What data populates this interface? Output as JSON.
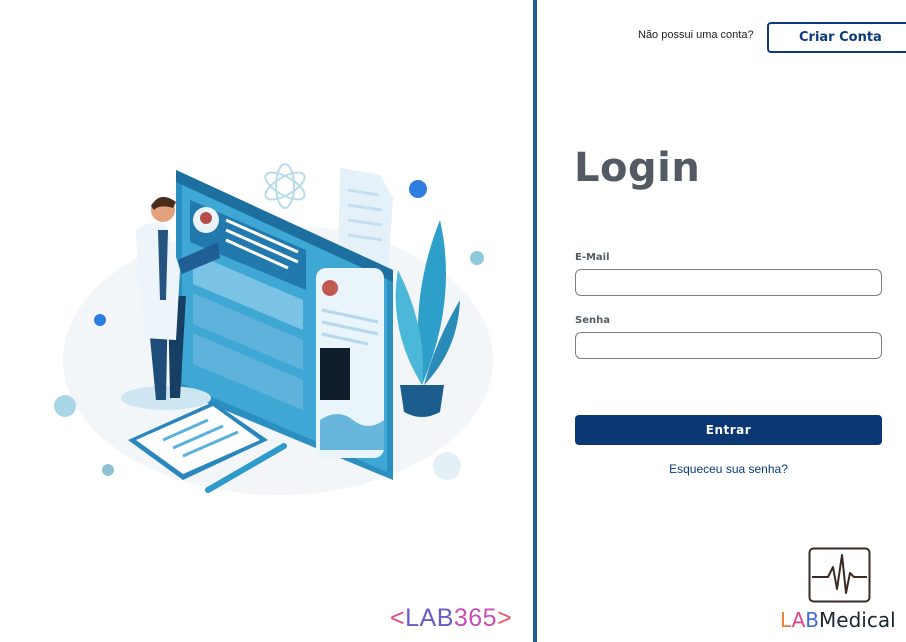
{
  "header": {
    "no_account_text": "Não possui uma conta?",
    "create_account_label": "Criar Conta"
  },
  "login": {
    "title": "Login",
    "email_label": "E-Mail",
    "email_value": "",
    "password_label": "Senha",
    "password_value": "",
    "submit_label": "Entrar",
    "forgot_label": "Esqueceu sua senha?"
  },
  "branding": {
    "left_logo": {
      "open": "<",
      "lab": "LAB",
      "num": "365",
      "close": ">"
    },
    "right_logo": {
      "l": "L",
      "a": "A",
      "b": "B",
      "rest": "Medical"
    }
  },
  "colors": {
    "divider": "#1f5f95",
    "primary": "#0b3775",
    "title": "#545a63"
  },
  "icons": [
    "doctor-dashboard-illustration",
    "heartbeat-monitor-icon"
  ]
}
